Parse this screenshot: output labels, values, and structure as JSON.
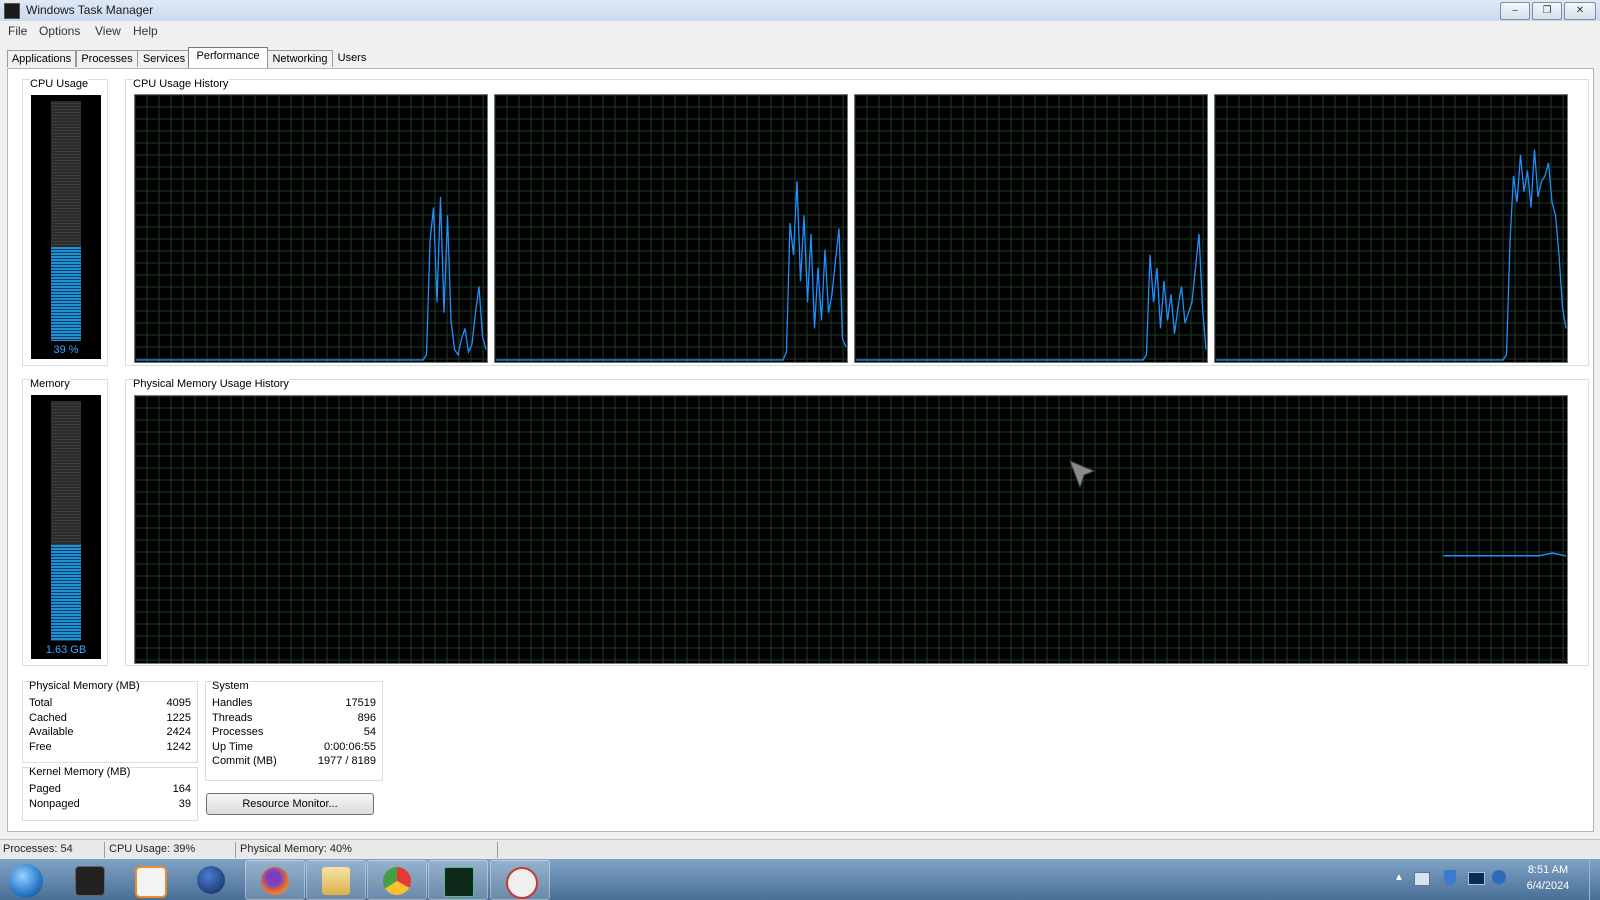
{
  "window": {
    "title": "Windows Task Manager",
    "min": "–",
    "max": "❐",
    "close": "✕"
  },
  "menu": {
    "items": [
      "File",
      "Options",
      "View",
      "Help"
    ]
  },
  "tabs": [
    "Applications",
    "Processes",
    "Services",
    "Performance",
    "Networking",
    "Users"
  ],
  "active_tab": "Performance",
  "cpu": {
    "label": "CPU Usage",
    "history_label": "CPU Usage History",
    "value_text": "39 %",
    "percent": 39,
    "colors": {
      "line": "#1e90ff",
      "grid": "#1c3b24",
      "bar": "#1e90d6"
    },
    "histories": [
      [
        0,
        0,
        0,
        0,
        0,
        0,
        0,
        0,
        0,
        0,
        0,
        0,
        0,
        0,
        0,
        0,
        0,
        0,
        0,
        0,
        0,
        0,
        0,
        0,
        0,
        0,
        0,
        0,
        0,
        0,
        0,
        0,
        0,
        0,
        0,
        0,
        0,
        0,
        0,
        0,
        0,
        0,
        0,
        0,
        0,
        0,
        0,
        0,
        0,
        0,
        0,
        0,
        0,
        0,
        0,
        0,
        0,
        0,
        0,
        0,
        0,
        0,
        0,
        0,
        0,
        0,
        0,
        0,
        0,
        0,
        0,
        0,
        0,
        0,
        0,
        0,
        0,
        0,
        0,
        0,
        0,
        0,
        0,
        2,
        45,
        58,
        22,
        62,
        18,
        55,
        15,
        4,
        2,
        8,
        12,
        3,
        6,
        18,
        28,
        9,
        4
      ],
      [
        0,
        0,
        0,
        0,
        0,
        0,
        0,
        0,
        0,
        0,
        0,
        0,
        0,
        0,
        0,
        0,
        0,
        0,
        0,
        0,
        0,
        0,
        0,
        0,
        0,
        0,
        0,
        0,
        0,
        0,
        0,
        0,
        0,
        0,
        0,
        0,
        0,
        0,
        0,
        0,
        0,
        0,
        0,
        0,
        0,
        0,
        0,
        0,
        0,
        0,
        0,
        0,
        0,
        0,
        0,
        0,
        0,
        0,
        0,
        0,
        0,
        0,
        0,
        0,
        0,
        0,
        0,
        0,
        0,
        0,
        0,
        0,
        0,
        0,
        0,
        0,
        0,
        0,
        0,
        0,
        0,
        0,
        0,
        3,
        52,
        40,
        68,
        30,
        55,
        22,
        48,
        12,
        35,
        15,
        42,
        18,
        25,
        38,
        50,
        8,
        5
      ],
      [
        0,
        0,
        0,
        0,
        0,
        0,
        0,
        0,
        0,
        0,
        0,
        0,
        0,
        0,
        0,
        0,
        0,
        0,
        0,
        0,
        0,
        0,
        0,
        0,
        0,
        0,
        0,
        0,
        0,
        0,
        0,
        0,
        0,
        0,
        0,
        0,
        0,
        0,
        0,
        0,
        0,
        0,
        0,
        0,
        0,
        0,
        0,
        0,
        0,
        0,
        0,
        0,
        0,
        0,
        0,
        0,
        0,
        0,
        0,
        0,
        0,
        0,
        0,
        0,
        0,
        0,
        0,
        0,
        0,
        0,
        0,
        0,
        0,
        0,
        0,
        0,
        0,
        0,
        0,
        0,
        0,
        0,
        0,
        2,
        40,
        22,
        35,
        12,
        30,
        15,
        25,
        10,
        20,
        28,
        14,
        18,
        22,
        35,
        48,
        20,
        4
      ],
      [
        0,
        0,
        0,
        0,
        0,
        0,
        0,
        0,
        0,
        0,
        0,
        0,
        0,
        0,
        0,
        0,
        0,
        0,
        0,
        0,
        0,
        0,
        0,
        0,
        0,
        0,
        0,
        0,
        0,
        0,
        0,
        0,
        0,
        0,
        0,
        0,
        0,
        0,
        0,
        0,
        0,
        0,
        0,
        0,
        0,
        0,
        0,
        0,
        0,
        0,
        0,
        0,
        0,
        0,
        0,
        0,
        0,
        0,
        0,
        0,
        0,
        0,
        0,
        0,
        0,
        0,
        0,
        0,
        0,
        0,
        0,
        0,
        0,
        0,
        0,
        0,
        0,
        0,
        0,
        0,
        0,
        0,
        0,
        2,
        45,
        70,
        60,
        78,
        64,
        72,
        58,
        80,
        62,
        68,
        70,
        75,
        60,
        55,
        40,
        20,
        12
      ]
    ]
  },
  "memory": {
    "label": "Memory",
    "history_label": "Physical Memory Usage History",
    "value_text": "1.63 GB",
    "percent": 40,
    "history": [
      0,
      0,
      0,
      0,
      0,
      0,
      0,
      0,
      0,
      0,
      0,
      0,
      0,
      0,
      0,
      0,
      0,
      0,
      0,
      0,
      0,
      0,
      0,
      0,
      0,
      0,
      0,
      0,
      0,
      0,
      0,
      0,
      0,
      0,
      0,
      0,
      0,
      0,
      0,
      0,
      0,
      0,
      0,
      0,
      0,
      0,
      0,
      0,
      0,
      0,
      0,
      0,
      0,
      0,
      0,
      0,
      0,
      0,
      0,
      0,
      0,
      0,
      0,
      0,
      0,
      0,
      0,
      0,
      0,
      0,
      0,
      0,
      0,
      0,
      0,
      0,
      0,
      0,
      0,
      0,
      0,
      0,
      0,
      0,
      0,
      0,
      0,
      0,
      0,
      0,
      0,
      0,
      0,
      0,
      0,
      0,
      40,
      40,
      40,
      40,
      40,
      40,
      40,
      40,
      41,
      40
    ]
  },
  "physical_memory": {
    "label": "Physical Memory (MB)",
    "rows": [
      {
        "k": "Total",
        "v": "4095"
      },
      {
        "k": "Cached",
        "v": "1225"
      },
      {
        "k": "Available",
        "v": "2424"
      },
      {
        "k": "Free",
        "v": "1242"
      }
    ]
  },
  "kernel_memory": {
    "label": "Kernel Memory (MB)",
    "rows": [
      {
        "k": "Paged",
        "v": "164"
      },
      {
        "k": "Nonpaged",
        "v": "39"
      }
    ]
  },
  "system": {
    "label": "System",
    "rows": [
      {
        "k": "Handles",
        "v": "17519"
      },
      {
        "k": "Threads",
        "v": "896"
      },
      {
        "k": "Processes",
        "v": "54"
      },
      {
        "k": "Up Time",
        "v": "0:00:06:55"
      },
      {
        "k": "Commit (MB)",
        "v": "1977 / 8189"
      }
    ]
  },
  "resource_button": "Resource Monitor...",
  "status": {
    "processes": "Processes: 54",
    "cpu": "CPU Usage: 39%",
    "memory": "Physical Memory: 40%"
  },
  "taskbar": {
    "items": [
      {
        "name": "start-button",
        "color": "#2f7fd0",
        "open": false
      },
      {
        "name": "terminal-icon",
        "color": "#222222",
        "open": false
      },
      {
        "name": "media-player-icon",
        "color": "#f08a24",
        "open": false
      },
      {
        "name": "globe-icon",
        "color": "#153a7a",
        "open": false
      },
      {
        "name": "firefox-icon",
        "color": "#e8702a",
        "open": true
      },
      {
        "name": "file-explorer-icon",
        "color": "#e9c46a",
        "open": true
      },
      {
        "name": "chrome-icon",
        "color": "#4caf50",
        "open": true
      },
      {
        "name": "task-manager-icon",
        "color": "#0d2a1a",
        "open": true
      },
      {
        "name": "clock-app-icon",
        "color": "#d0d0d0",
        "open": true
      }
    ],
    "time": "8:51 AM",
    "date": "6/4/2024"
  }
}
